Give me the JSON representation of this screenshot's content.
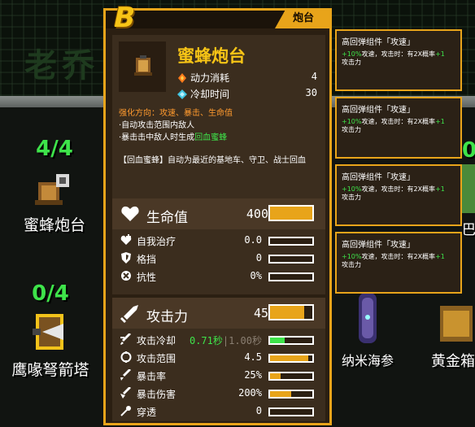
{
  "background": {
    "title_text": "老乔",
    "units": [
      {
        "count": "4/4",
        "name": "蜜蜂炮台"
      },
      {
        "count": "0/4",
        "name": "鹰喙弩箭塔"
      },
      {
        "count": "",
        "name": "纳米海参"
      },
      {
        "count": "",
        "name": "黄金箱"
      },
      {
        "count": "0",
        "name": "巴"
      }
    ]
  },
  "panel": {
    "grade": "B",
    "tab_label": "炮台",
    "unit_name": "蜜蜂炮台",
    "energy_label": "动力消耗",
    "energy_value": "4",
    "cooldown_label": "冷却时间",
    "cooldown_value": "30",
    "upgrade_path": "强化方向：攻速、暴击、生命值",
    "bullet_1": "·自动攻击范围内敌人",
    "bullet_2_prefix": "·暴击击中敌人时生成",
    "bullet_2_link": "回血蜜蜂",
    "note": "【回血蜜蜂】自动为最近的基地车、守卫、战士回血"
  },
  "health_section": {
    "title": "生命值",
    "value": "400",
    "fill": 1.0,
    "rows": [
      {
        "label": "自我治疗",
        "value": "0.0",
        "fill": 0
      },
      {
        "label": "格挡",
        "value": "0",
        "fill": 0
      },
      {
        "label": "抗性",
        "value": "0%",
        "fill": 0
      }
    ]
  },
  "attack_section": {
    "title": "攻击力",
    "value": "45",
    "fill": 0.8,
    "rows": [
      {
        "label": "攻击冷却",
        "value_green": "0.71秒",
        "value_dim": "|1.00秒",
        "fill": 0.35,
        "green": true
      },
      {
        "label": "攻击范围",
        "value": "4.5",
        "fill": 0.9
      },
      {
        "label": "暴击率",
        "value": "25%",
        "fill": 0.25
      },
      {
        "label": "暴击伤害",
        "value": "200%",
        "fill": 0.5
      },
      {
        "label": "穿透",
        "value": "0",
        "fill": 0
      }
    ]
  },
  "cards": [
    {
      "title": "高回弹组件「攻速」",
      "desc_green": "+10%",
      "desc_mid": "攻速，攻击时：有2X概率",
      "desc_green2": "+1",
      "desc_end": "攻击力"
    },
    {
      "title": "高回弹组件「攻速」",
      "desc_green": "+10%",
      "desc_mid": "攻速，攻击时：有2X概率",
      "desc_green2": "+1",
      "desc_end": "攻击力"
    },
    {
      "title": "高回弹组件「攻速」",
      "desc_green": "+10%",
      "desc_mid": "攻速，攻击时：有2X概率",
      "desc_green2": "+1",
      "desc_end": "攻击力"
    },
    {
      "title": "高回弹组件「攻速」",
      "desc_green": "+10%",
      "desc_mid": "攻速，攻击时：有2X概率",
      "desc_green2": "+1",
      "desc_end": "攻击力"
    }
  ],
  "colors": {
    "accent": "#e8a41a",
    "grade": "#f7c416",
    "positive": "#3ee34a",
    "upgrade": "#ff9a2e"
  },
  "icons": [
    "heart-icon",
    "sword-icon",
    "heal-icon",
    "shield-icon",
    "resist-icon",
    "cooldown-icon",
    "range-icon",
    "crit-rate-icon",
    "crit-dmg-icon",
    "pierce-icon",
    "energy-icon",
    "snowflake-icon",
    "bee-turret-icon"
  ]
}
